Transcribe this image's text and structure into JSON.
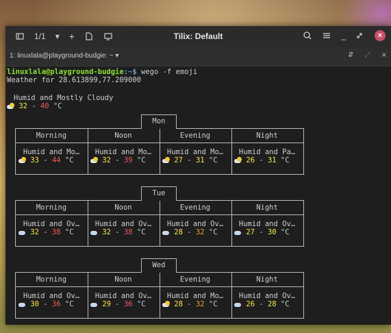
{
  "window": {
    "title": "Tilix: Default",
    "session_counter": "1/1",
    "tab_label": "1: linuxlala@playground-budgie: ~"
  },
  "terminal": {
    "prompt_user": "linuxlala@playground-budgie",
    "prompt_path": ":~$",
    "command": " wego -f emoji",
    "weather_for": "Weather for 28.613899,77.209000",
    "current": {
      "desc": "Humid and Mostly Cloudy",
      "t1": "32",
      "dash": "-",
      "t2": "40",
      "unit": "°C"
    },
    "columns": [
      "Morning",
      "Noon",
      "Evening",
      "Night"
    ],
    "days": [
      {
        "name": "Mon",
        "slots": [
          {
            "desc": "Humid and Mo…",
            "t1": "33",
            "t2": "44",
            "unit": "°C",
            "icon": "partly-cloudy-icon"
          },
          {
            "desc": "Humid and Mo…",
            "t1": "32",
            "t2": "39",
            "unit": "°C",
            "icon": "partly-cloudy-icon"
          },
          {
            "desc": "Humid and Mo…",
            "t1": "27",
            "t2": "31",
            "unit": "°C",
            "icon": "partly-cloudy-icon"
          },
          {
            "desc": "Humid and Pa…",
            "t1": "26",
            "t2": "31",
            "unit": "°C",
            "icon": "partly-cloudy-icon"
          }
        ]
      },
      {
        "name": "Tue",
        "slots": [
          {
            "desc": "Humid and Ov…",
            "t1": "32",
            "t2": "38",
            "unit": "°C",
            "icon": "cloud-icon"
          },
          {
            "desc": "Humid and Ov…",
            "t1": "32",
            "t2": "38",
            "unit": "°C",
            "icon": "cloud-icon"
          },
          {
            "desc": "Humid and Ov…",
            "t1": "28",
            "t2": "32",
            "unit": "°C",
            "icon": "cloud-icon"
          },
          {
            "desc": "Humid and Ov…",
            "t1": "27",
            "t2": "30",
            "unit": "°C",
            "icon": "cloud-icon"
          }
        ]
      },
      {
        "name": "Wed",
        "slots": [
          {
            "desc": "Humid and Ov…",
            "t1": "30",
            "t2": "36",
            "unit": "°C",
            "icon": "cloud-icon"
          },
          {
            "desc": "Humid and Ov…",
            "t1": "29",
            "t2": "36",
            "unit": "°C",
            "icon": "cloud-icon"
          },
          {
            "desc": "Humid and Mo…",
            "t1": "28",
            "t2": "32",
            "unit": "°C",
            "icon": "partly-cloudy-icon"
          },
          {
            "desc": "Humid and Ov…",
            "t1": "26",
            "t2": "28",
            "unit": "°C",
            "icon": "cloud-icon"
          }
        ]
      }
    ]
  },
  "colors": {
    "prompt_user": "#8ae234",
    "prompt_path": "#729fcf",
    "temp_low": "#fce94f",
    "temp_high": "#ef5b5b",
    "close_button": "#c8506a"
  }
}
